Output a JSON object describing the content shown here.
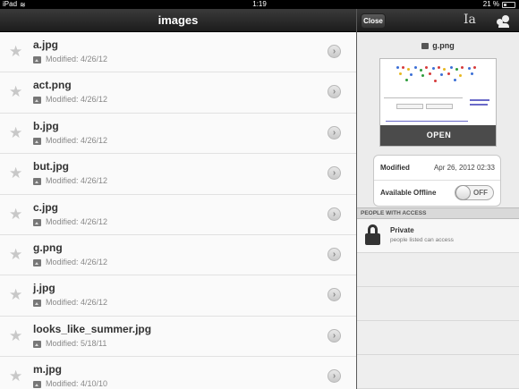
{
  "status_bar": {
    "device": "iPad",
    "time": "1:19",
    "battery": "21 %"
  },
  "left_panel": {
    "title": "images",
    "files": [
      {
        "name": "a.jpg",
        "modified": "Modified: 4/26/12"
      },
      {
        "name": "act.png",
        "modified": "Modified: 4/26/12"
      },
      {
        "name": "b.jpg",
        "modified": "Modified: 4/26/12"
      },
      {
        "name": "but.jpg",
        "modified": "Modified: 4/26/12"
      },
      {
        "name": "c.jpg",
        "modified": "Modified: 4/26/12"
      },
      {
        "name": "g.png",
        "modified": "Modified: 4/26/12"
      },
      {
        "name": "j.jpg",
        "modified": "Modified: 4/26/12"
      },
      {
        "name": "looks_like_summer.jpg",
        "modified": "Modified: 5/18/11"
      },
      {
        "name": "m.jpg",
        "modified": "Modified: 4/10/10"
      }
    ]
  },
  "detail_panel": {
    "close_label": "Close",
    "rename_glyph": "Ia",
    "file_name": "g.png",
    "open_label": "OPEN",
    "info": {
      "modified_label": "Modified",
      "modified_value": "Apr 26, 2012 02:33",
      "offline_label": "Available Offline",
      "offline_state": "OFF"
    },
    "access_section": "PEOPLE WITH ACCESS",
    "access": {
      "title": "Private",
      "subtitle": "people listed can access"
    }
  },
  "colors": {
    "header_dark": "#1c1c1c",
    "list_bg": "#fafafa",
    "panel_bg": "#ececec"
  }
}
